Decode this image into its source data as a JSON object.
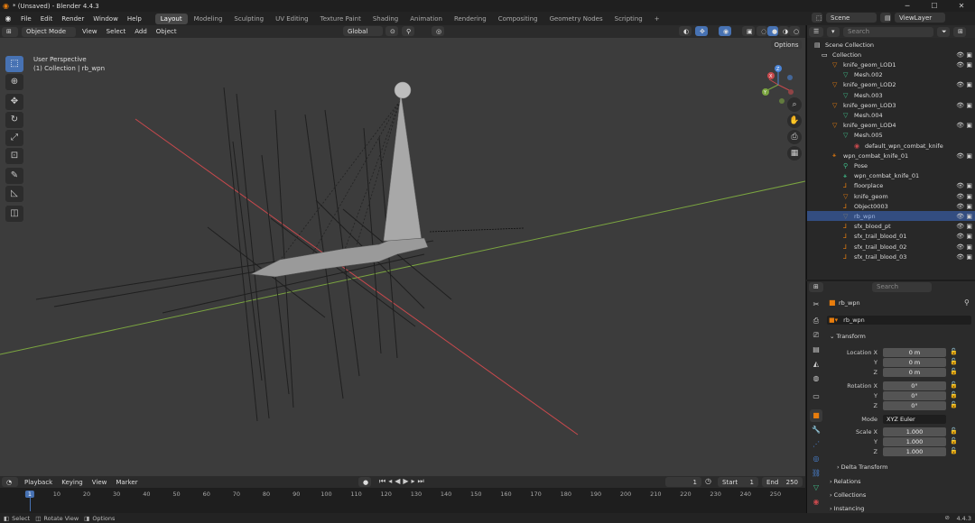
{
  "window": {
    "title": "* (Unsaved) - Blender 4.4.3"
  },
  "menu": [
    "File",
    "Edit",
    "Render",
    "Window",
    "Help"
  ],
  "workspaces": [
    "Layout",
    "Modeling",
    "Sculpting",
    "UV Editing",
    "Texture Paint",
    "Shading",
    "Animation",
    "Rendering",
    "Compositing",
    "Geometry Nodes",
    "Scripting"
  ],
  "viewport": {
    "mode": "Object Mode",
    "menus": [
      "View",
      "Select",
      "Add",
      "Object"
    ],
    "orientation": "Global",
    "options": "Options",
    "overlay_line1": "User Perspective",
    "overlay_line2": "(1) Collection | rb_wpn"
  },
  "scene": {
    "scene_label": "Scene",
    "view_layer": "ViewLayer",
    "search_placeholder": "Search"
  },
  "outliner": {
    "rows": [
      {
        "label": "Scene Collection"
      },
      {
        "label": "Collection"
      },
      {
        "label": "knife_geom_LOD1"
      },
      {
        "label": "Mesh.002"
      },
      {
        "label": "knife_geom_LOD2"
      },
      {
        "label": "Mesh.003"
      },
      {
        "label": "knife_geom_LOD3"
      },
      {
        "label": "Mesh.004"
      },
      {
        "label": "knife_geom_LOD4"
      },
      {
        "label": "Mesh.005"
      },
      {
        "label": "default_wpn_combat_knife"
      },
      {
        "label": "wpn_combat_knife_01"
      },
      {
        "label": "Pose"
      },
      {
        "label": "wpn_combat_knife_01"
      },
      {
        "label": "floorplace"
      },
      {
        "label": "knife_geom"
      },
      {
        "label": "Object0003"
      },
      {
        "label": "rb_wpn"
      },
      {
        "label": "sfx_blood_pt"
      },
      {
        "label": "sfx_trail_blood_01"
      },
      {
        "label": "sfx_trail_blood_02"
      },
      {
        "label": "sfx_trail_blood_03"
      }
    ]
  },
  "properties": {
    "search_placeholder": "Search",
    "object_name": "rb_wpn",
    "data_name": "rb_wpn",
    "transform_label": "Transform",
    "location_x_label": "Location X",
    "y_label": "Y",
    "z_label": "Z",
    "location": [
      "0 m",
      "0 m",
      "0 m"
    ],
    "rotation_x_label": "Rotation X",
    "rotation": [
      "0°",
      "0°",
      "0°"
    ],
    "mode_label": "Mode",
    "rotation_mode": "XYZ Euler",
    "scale_x_label": "Scale X",
    "scale": [
      "1.000",
      "1.000",
      "1.000"
    ],
    "delta_transform": "Delta Transform",
    "relations": "Relations",
    "collections": "Collections",
    "instancing": "Instancing"
  },
  "timeline": {
    "menus": [
      "Playback",
      "Keying",
      "View",
      "Marker"
    ],
    "current_frame": "1",
    "start_label": "Start",
    "start": "1",
    "end_label": "End",
    "end": "250",
    "ticks": [
      "1",
      "10",
      "20",
      "30",
      "40",
      "50",
      "60",
      "70",
      "80",
      "90",
      "100",
      "110",
      "120",
      "130",
      "140",
      "150",
      "160",
      "170",
      "180",
      "190",
      "200",
      "210",
      "220",
      "230",
      "240",
      "250"
    ]
  },
  "statusbar": {
    "select": "Select",
    "rotate": "Rotate View",
    "options": "Options",
    "version": "4.4.3"
  },
  "colors": {
    "accent": "#4772b3",
    "x_axis": "#c8494d",
    "y_axis": "#7ba540",
    "z_axis": "#4a84d6",
    "viewport_bg": "#3c3c3c"
  }
}
